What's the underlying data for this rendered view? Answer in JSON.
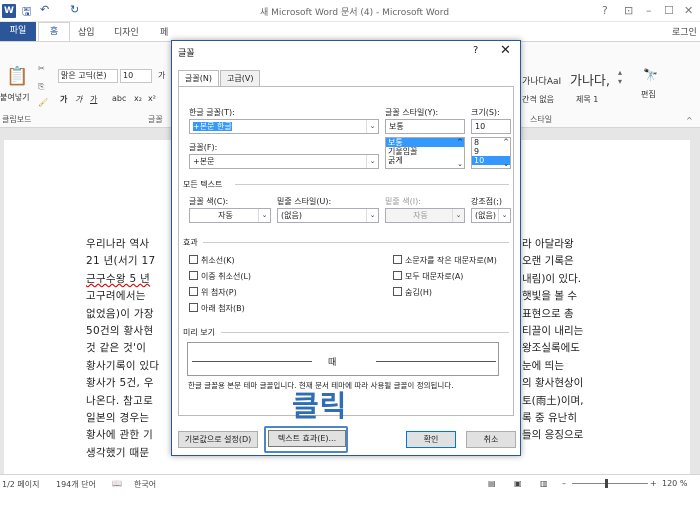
{
  "window": {
    "title": "새 Microsoft Word 문서 (4) - Microsoft Word",
    "help": "?",
    "login": "로그인"
  },
  "tabs": [
    "파일",
    "홈",
    "삽입",
    "디자인",
    "페"
  ],
  "ribbon": {
    "paste": "붙여넣기",
    "clipboard": "클립보드",
    "font_name": "맑은 고딕(본)",
    "font_size": "10",
    "font_group": "글꼴",
    "style_preview_1": "가나다AaI",
    "style_preview_2": "가나다,",
    "style_name_1": "간격 없음",
    "style_name_2": "제목 1",
    "style_group": "스타일",
    "edit": "편집"
  },
  "body_lines": [
    "우리나라 역사",
    "21 년(서기 17",
    "근구수왕 5 년",
    "고구려에서는 ",
    "없었음)이 가장",
    "50건의 황사현",
    "것 같은 것'이",
    "황사기록이 있다",
    "황사가 5건, 우",
    "나온다. 참고로",
    "일본의 경우는",
    "황사에 관한 기",
    "생각했기 때문"
  ],
  "body_right": [
    "라 아달라왕",
    "오랜 기록은",
    "내림)이 있다.",
    "햇빛을 볼 수",
    "표현으로 총",
    "티끌이 내리는",
    "왕조실록에도",
    "눈에 띄는",
    "의 황사현상이",
    "토(雨土)이며,",
    "록 중 유난히",
    "들의 응징으로",
    ""
  ],
  "status": {
    "page": "1/2 페이지",
    "words": "194개 단어",
    "lang": "한국어",
    "zoom": "120 %"
  },
  "dialog": {
    "title": "글꼴",
    "help": "?",
    "close": "✕",
    "tab_font": "글꼴(N)",
    "tab_advanced": "고급(V)",
    "hangul_font_label": "한글 글꼴(T):",
    "hangul_font_value": "+본문 한글",
    "font_label": "글꼴(F):",
    "font_value": "+본문",
    "style_label": "글꼴 스타일(Y):",
    "style_value": "보통",
    "style_options": [
      "보통",
      "기울임꼴",
      "굵게"
    ],
    "size_label": "크기(S):",
    "size_value": "10",
    "size_options": [
      "8",
      "9",
      "10"
    ],
    "all_text": "모든 텍스트",
    "color_label": "글꼴 색(C):",
    "color_value": "자동",
    "underline_label": "밑줄 스타일(U):",
    "underline_value": "(없음)",
    "underline_color_label": "밑줄 색(I):",
    "underline_color_value": "자동",
    "emphasis_label": "강조점(;)",
    "emphasis_value": "(없음)",
    "effects": "효과",
    "checks_left": [
      "취소선(K)",
      "이중 취소선(L)",
      "위 첨자(P)",
      "아래 첨자(B)"
    ],
    "checks_right": [
      "소문자를 작은 대문자로(M)",
      "모두 대문자로(A)",
      "숨김(H)"
    ],
    "preview": "미리 보기",
    "preview_text": "때",
    "preview_note": "한글 글꼴용 본문 테마 글꼴입니다. 현재 문서 테마에 따라 사용될 글꼴이 정의됩니다.",
    "btn_default": "기본값으로 설정(D)",
    "btn_effects": "텍스트 효과(E)...",
    "btn_ok": "확인",
    "btn_cancel": "취소"
  },
  "annotation": "클릭"
}
